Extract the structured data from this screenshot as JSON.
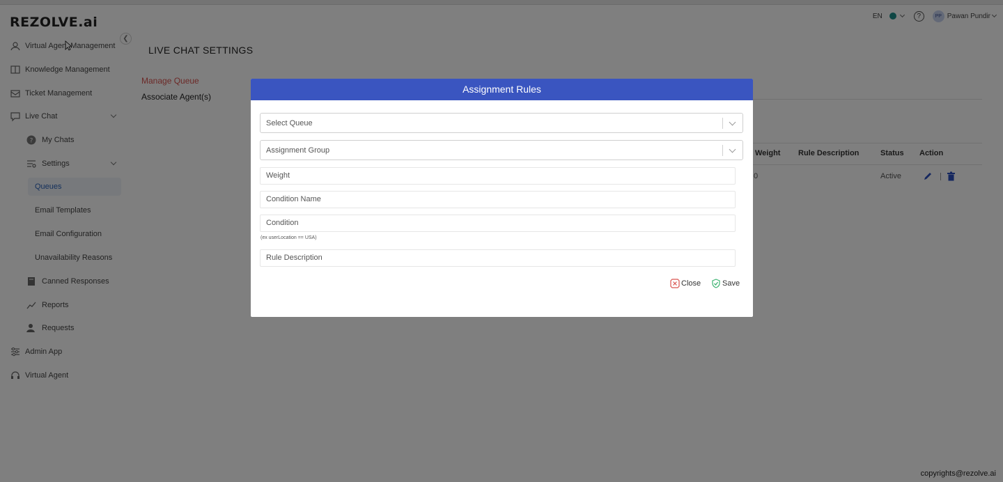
{
  "app": {
    "logo": "REZOLVE.ai"
  },
  "header": {
    "lang": "EN",
    "help": "?",
    "avatar_initials": "PP",
    "user_name": "Pawan Pundir"
  },
  "sidebar": {
    "items": [
      {
        "label": "Virtual Agent Management",
        "icon": "agent-icon"
      },
      {
        "label": "Knowledge Management",
        "icon": "book-icon"
      },
      {
        "label": "Ticket Management",
        "icon": "ticket-icon"
      },
      {
        "label": "Live Chat",
        "icon": "chat-icon"
      },
      {
        "label": "My Chats",
        "icon": "question-circle-icon"
      },
      {
        "label": "Settings",
        "icon": "sliders-icon"
      },
      {
        "label": "Queues"
      },
      {
        "label": "Email Templates"
      },
      {
        "label": "Email Configuration"
      },
      {
        "label": "Unavailability Reasons"
      },
      {
        "label": "Canned Responses",
        "icon": "book-stack-icon"
      },
      {
        "label": "Reports",
        "icon": "chart-line-icon"
      },
      {
        "label": "Requests",
        "icon": "user-request-icon"
      },
      {
        "label": "Admin App",
        "icon": "sliders-icon"
      },
      {
        "label": "Virtual Agent",
        "icon": "headset-icon"
      }
    ],
    "active": "Queues"
  },
  "page": {
    "title": "LIVE CHAT SETTINGS",
    "tabs": [
      "Manage Queue",
      "Associate Agent(s)"
    ]
  },
  "table": {
    "columns": [
      "Weight",
      "Rule Description",
      "Status",
      "Action"
    ],
    "rows": [
      {
        "weight": "0",
        "rule_description": "",
        "status": "Active"
      }
    ]
  },
  "modal": {
    "title": "Assignment Rules",
    "select_queue": "Select Queue",
    "assignment_group": "Assignment Group",
    "weight": "Weight",
    "condition_name": "Condition Name",
    "condition": "Condition",
    "condition_hint": "(ex userLocation == USA)",
    "rule_description": "Rule Description",
    "close_label": "Close",
    "save_label": "Save"
  },
  "footer": {
    "copyright": "copyrights@rezolve.ai"
  },
  "colors": {
    "modal_header": "#3a55c0",
    "active_tab": "#d9534f",
    "close_icon": "#d9534f",
    "save_icon": "#3cb371",
    "status_dot": "#1d8c89"
  }
}
